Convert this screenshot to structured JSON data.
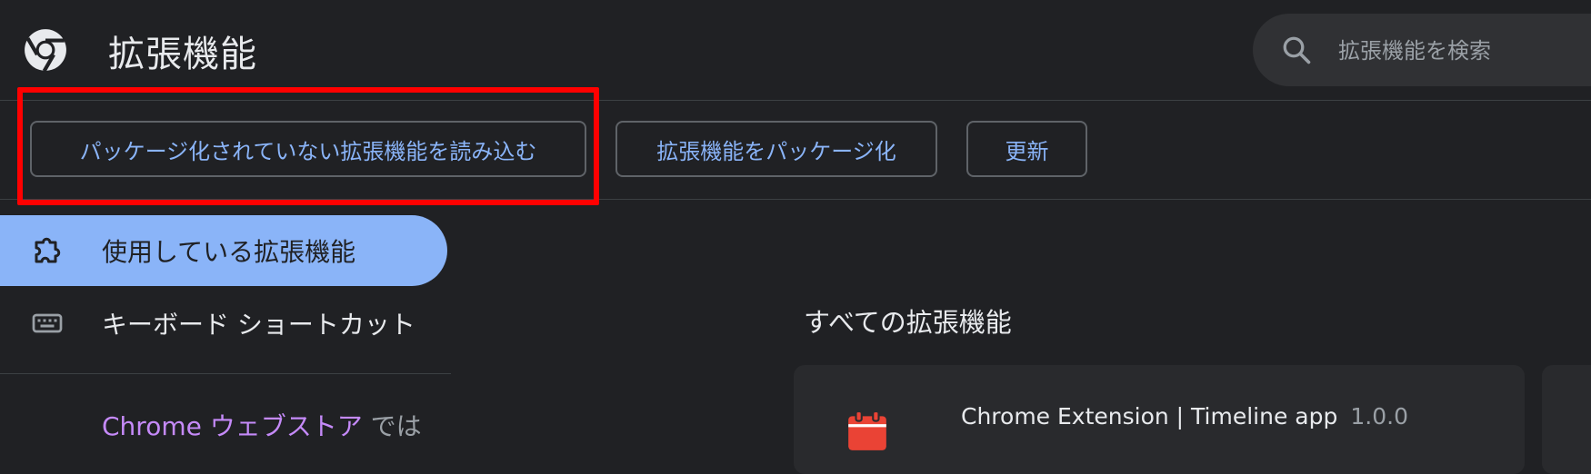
{
  "header": {
    "title": "拡張機能",
    "logo": "chrome-logo-icon",
    "search": {
      "placeholder": "拡張機能を検索",
      "icon": "search-icon"
    }
  },
  "toolbar": {
    "load_unpacked": "パッケージ化されていない拡張機能を読み込む",
    "pack_extension": "拡張機能をパッケージ化",
    "update": "更新"
  },
  "sidebar": {
    "items": [
      {
        "label": "使用している拡張機能",
        "icon": "puzzle-piece-icon",
        "active": true
      },
      {
        "label": "キーボード ショートカット",
        "icon": "keyboard-icon",
        "active": false
      }
    ],
    "webstore": {
      "link": "Chrome ウェブストア",
      "suffix": " では"
    }
  },
  "main": {
    "section_title": "すべての拡張機能",
    "extensions": [
      {
        "name": "Chrome Extension | Timeline app",
        "version": "1.0.0",
        "icon": "calendar-icon"
      }
    ]
  },
  "colors": {
    "background": "#202124",
    "accent": "#8ab4f8",
    "highlight": "#ff0000",
    "link": "#c58af9",
    "calendar_icon": "#ea4335"
  }
}
